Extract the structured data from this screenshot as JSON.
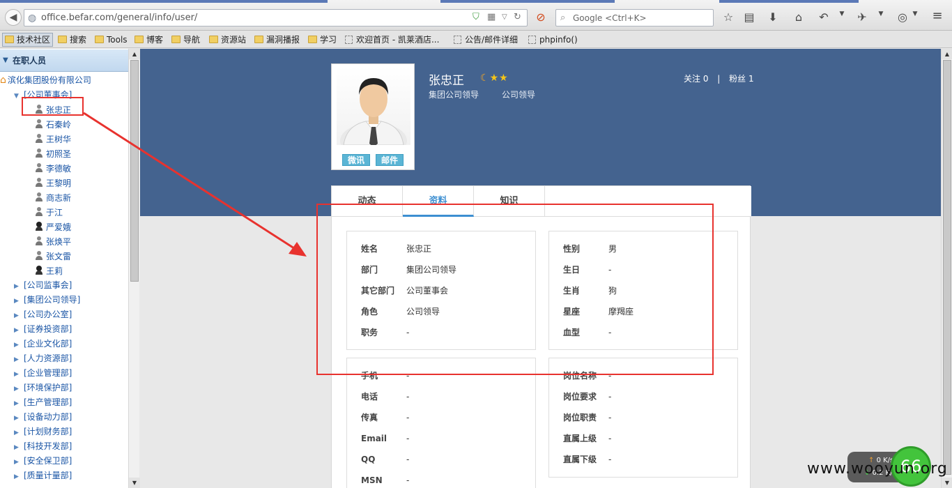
{
  "browser": {
    "url": "office.befar.com/general/info/user/",
    "search_placeholder": "Google <Ctrl+K>"
  },
  "bookmarks": [
    {
      "label": "技术社区",
      "type": "folder"
    },
    {
      "label": "搜索",
      "type": "folder"
    },
    {
      "label": "Tools",
      "type": "folder"
    },
    {
      "label": "博客",
      "type": "folder"
    },
    {
      "label": "导航",
      "type": "folder"
    },
    {
      "label": "资源站",
      "type": "folder"
    },
    {
      "label": "漏洞播报",
      "type": "folder"
    },
    {
      "label": "学习",
      "type": "folder"
    },
    {
      "label": "欢迎首页 - 凯莱酒店...",
      "type": "page"
    },
    {
      "label": "公告/邮件详细",
      "type": "page"
    },
    {
      "label": "phpinfo()",
      "type": "page"
    }
  ],
  "sidebar": {
    "title": "在职人员",
    "root": "滨化集团股份有限公司",
    "expanded_group": "[公司董事会]",
    "members": [
      {
        "name": "张忠正",
        "gender": "m"
      },
      {
        "name": "石秦岭",
        "gender": "m"
      },
      {
        "name": "王树华",
        "gender": "m"
      },
      {
        "name": "初照圣",
        "gender": "m"
      },
      {
        "name": "李德敏",
        "gender": "m"
      },
      {
        "name": "王黎明",
        "gender": "m"
      },
      {
        "name": "商志新",
        "gender": "m"
      },
      {
        "name": "于江",
        "gender": "m"
      },
      {
        "name": "严爱娥",
        "gender": "f"
      },
      {
        "name": "张焕平",
        "gender": "m"
      },
      {
        "name": "张文雷",
        "gender": "m"
      },
      {
        "name": "王莉",
        "gender": "f"
      }
    ],
    "groups": [
      "[公司监事会]",
      "[集团公司领导]",
      "[公司办公室]",
      "[证券投资部]",
      "[企业文化部]",
      "[人力资源部]",
      "[企业管理部]",
      "[环境保护部]",
      "[生产管理部]",
      "[设备动力部]",
      "[计划财务部]",
      "[科技开发部]",
      "[安全保卫部]",
      "[质量计量部]"
    ]
  },
  "profile": {
    "name": "张忠正",
    "dept": "集团公司领导",
    "role": "公司领导",
    "follow_label": "关注 0",
    "fans_label": "粉丝 1",
    "separator": "|",
    "btn_weixun": "微讯",
    "btn_mail": "邮件",
    "tabs": [
      "动态",
      "资料",
      "知识"
    ],
    "active_tab": "资料",
    "basic_left": [
      {
        "k": "姓名",
        "v": "张忠正"
      },
      {
        "k": "部门",
        "v": "集团公司领导"
      },
      {
        "k": "其它部门",
        "v": "公司董事会"
      },
      {
        "k": "角色",
        "v": "公司领导"
      },
      {
        "k": "职务",
        "v": "-"
      }
    ],
    "basic_right": [
      {
        "k": "性别",
        "v": "男"
      },
      {
        "k": "生日",
        "v": "-"
      },
      {
        "k": "生肖",
        "v": "狗"
      },
      {
        "k": "星座",
        "v": "摩羯座"
      },
      {
        "k": "血型",
        "v": "-"
      }
    ],
    "contact_left": [
      {
        "k": "手机",
        "v": "-"
      },
      {
        "k": "电话",
        "v": "-"
      },
      {
        "k": "传真",
        "v": "-"
      },
      {
        "k": "Email",
        "v": "-"
      },
      {
        "k": "QQ",
        "v": "-"
      },
      {
        "k": "MSN",
        "v": "-"
      }
    ],
    "contact_right": [
      {
        "k": "岗位名称",
        "v": "-"
      },
      {
        "k": "岗位要求",
        "v": "-"
      },
      {
        "k": "岗位职责",
        "v": "-"
      },
      {
        "k": "直属上级",
        "v": "-"
      },
      {
        "k": "直属下级",
        "v": "-"
      }
    ]
  },
  "widget": {
    "up_speed": "0 K/s",
    "down_speed": "0.2 K/s",
    "percent": "66"
  },
  "watermark": "www.wooyun.org",
  "colors": {
    "banner": "#44638f",
    "annotation": "#e8322e",
    "tab_active": "#3d8fd1",
    "link": "#1a55a5"
  }
}
